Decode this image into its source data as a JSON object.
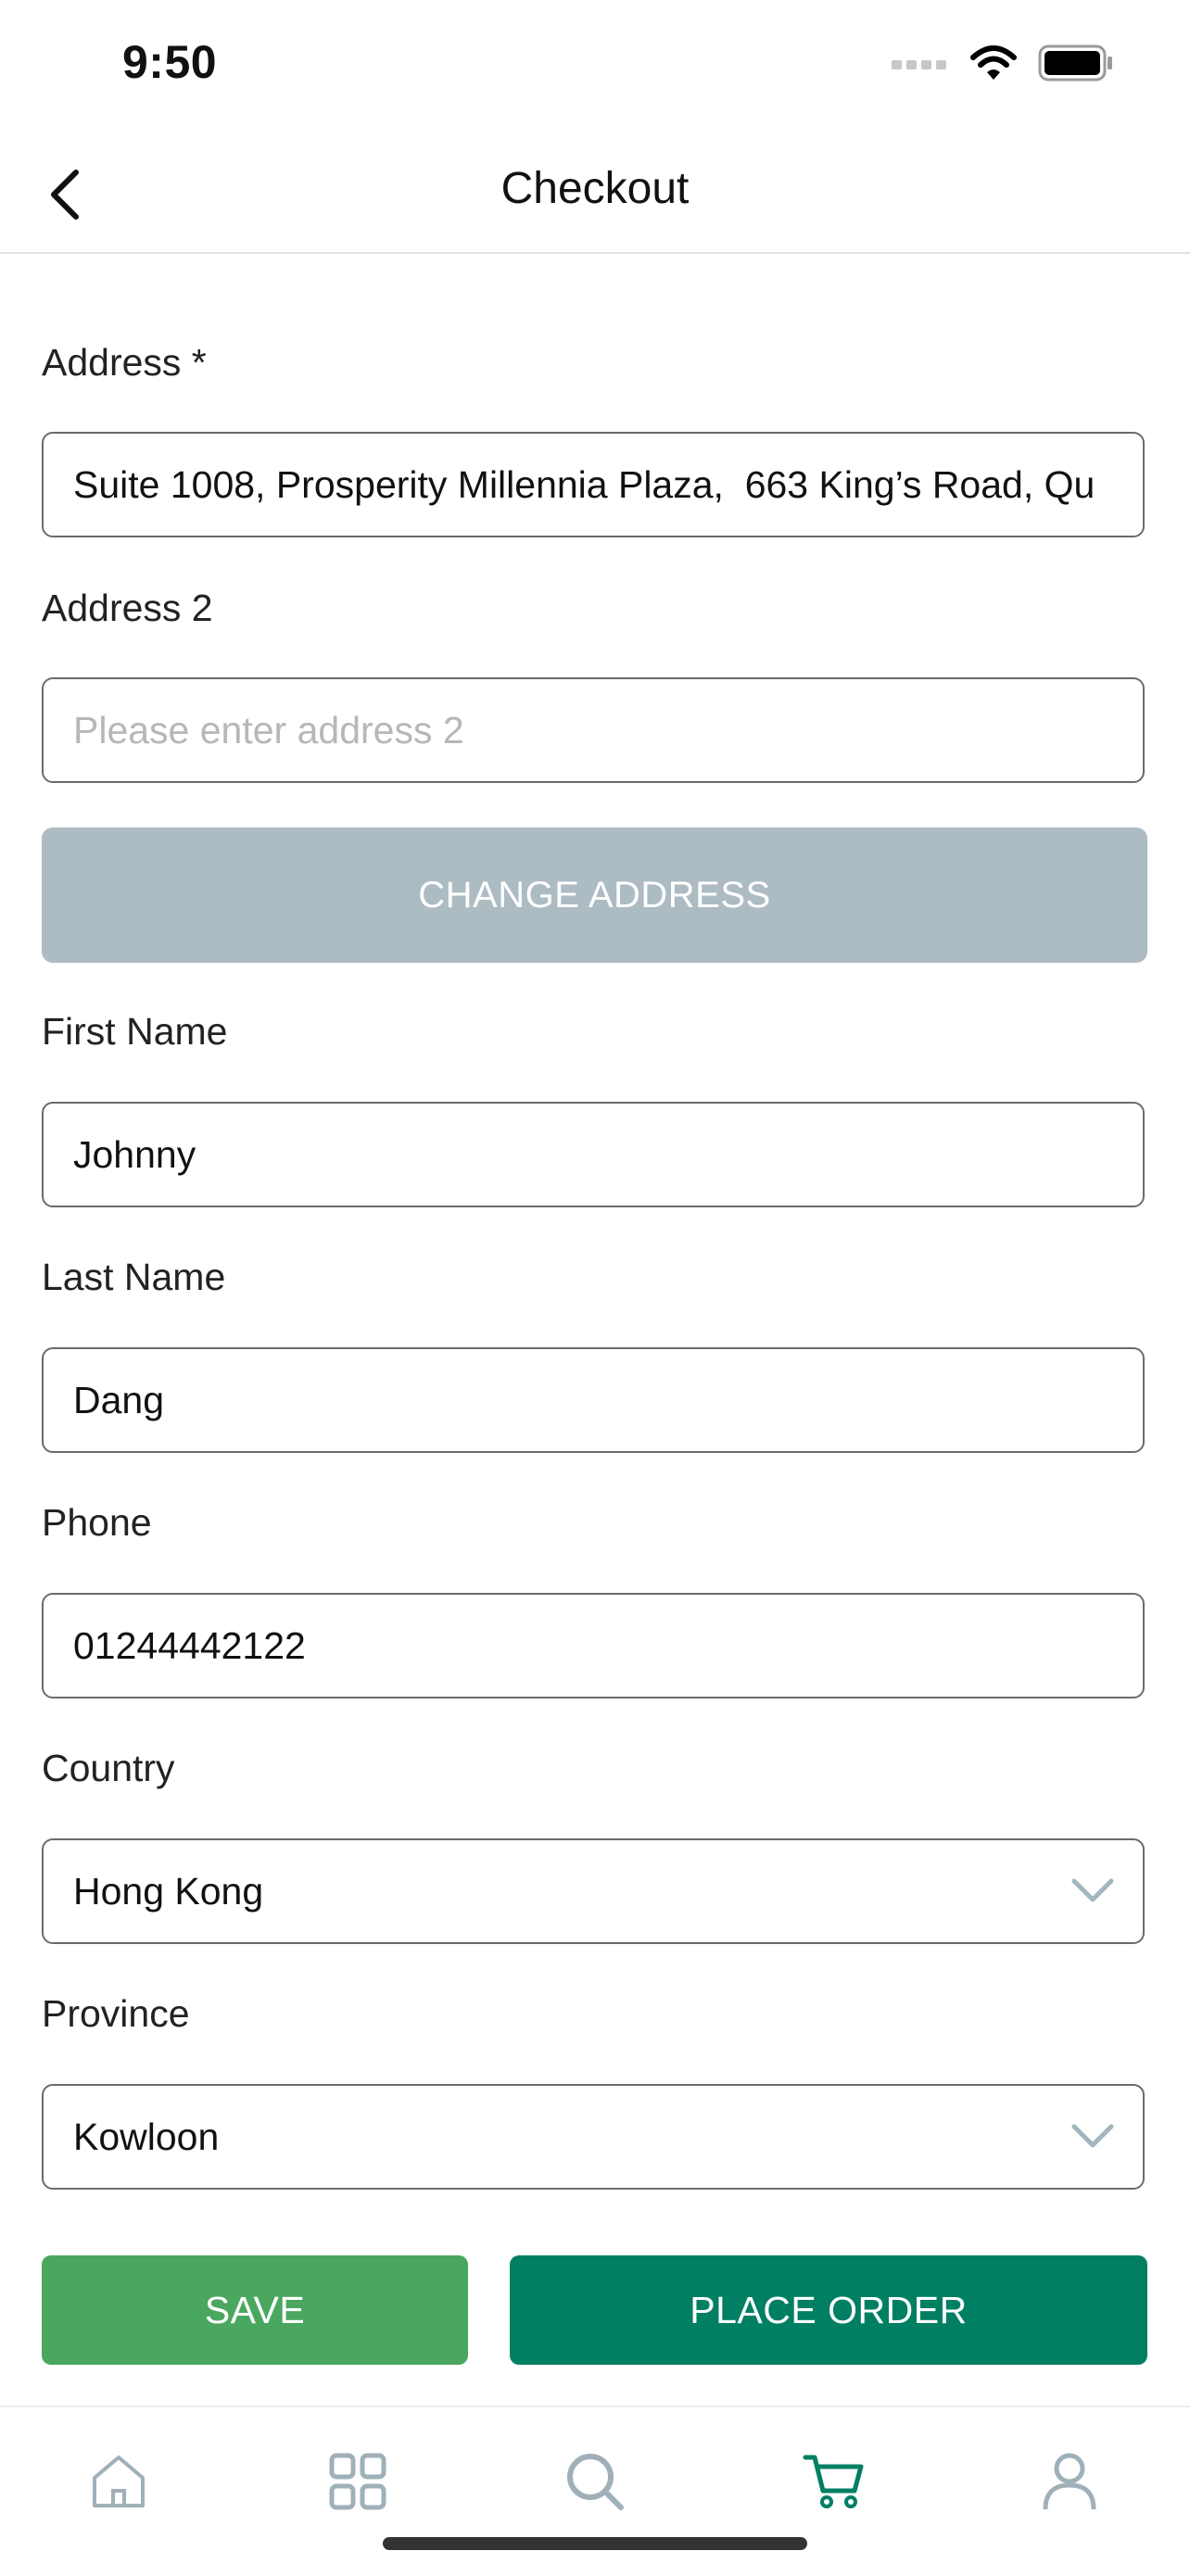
{
  "status_bar": {
    "time": "9:50"
  },
  "header": {
    "title": "Checkout"
  },
  "form": {
    "address": {
      "label": "Address *",
      "value": "Suite 1008, Prosperity Millennia Plaza,  663 King’s Road, Qu"
    },
    "address2": {
      "label": "Address 2",
      "value": "",
      "placeholder": "Please enter address 2"
    },
    "change_address_label": "CHANGE ADDRESS",
    "first_name": {
      "label": "First Name",
      "value": "Johnny"
    },
    "last_name": {
      "label": "Last Name",
      "value": "Dang"
    },
    "phone": {
      "label": "Phone",
      "value": "01244442122"
    },
    "country": {
      "label": "Country",
      "value": "Hong Kong"
    },
    "province": {
      "label": "Province",
      "value": "Kowloon"
    }
  },
  "actions": {
    "save_label": "SAVE",
    "place_order_label": "PLACE ORDER"
  },
  "tab_bar": {
    "items": [
      {
        "icon": "home-icon",
        "active": false
      },
      {
        "icon": "grid-icon",
        "active": false
      },
      {
        "icon": "search-icon",
        "active": false
      },
      {
        "icon": "cart-icon",
        "active": true
      },
      {
        "icon": "user-icon",
        "active": false
      }
    ]
  },
  "colors": {
    "save": "#4aa75f",
    "place_order": "#007f63",
    "change_address": "#adbbc2",
    "tab_active": "#007f63",
    "tab_inactive": "#9fb0b9"
  }
}
